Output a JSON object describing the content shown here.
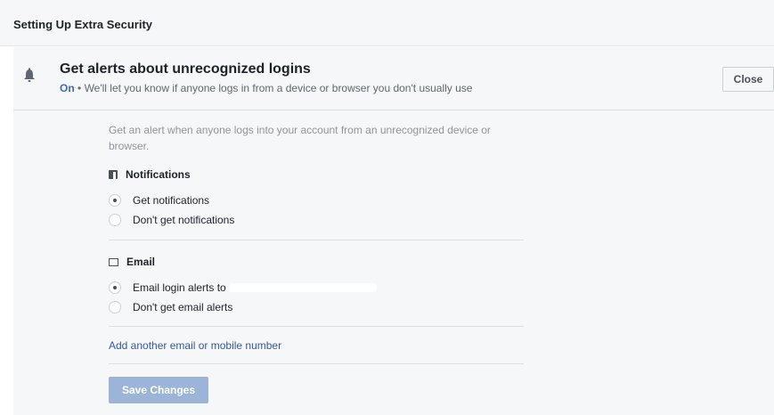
{
  "header": {
    "title": "Setting Up Extra Security"
  },
  "alert": {
    "title": "Get alerts about unrecognized logins",
    "status": "On",
    "separator": "•",
    "description": "We'll let you know if anyone logs in from a device or browser you don't usually use",
    "close_label": "Close"
  },
  "content": {
    "intro": "Get an alert when anyone logs into your account from an unrecognized device or browser.",
    "notifications": {
      "heading": "Notifications",
      "options": [
        {
          "label": "Get notifications",
          "selected": true
        },
        {
          "label": "Don't get notifications",
          "selected": false
        }
      ]
    },
    "email": {
      "heading": "Email",
      "options": [
        {
          "label": "Email login alerts to",
          "selected": true
        },
        {
          "label": "Don't get email alerts",
          "selected": false
        }
      ]
    },
    "add_link": "Add another email or mobile number",
    "save_label": "Save Changes"
  },
  "icons": [
    "bell-icon",
    "facebook-icon",
    "envelope-icon"
  ],
  "colors": {
    "accent": "#4267b2",
    "link": "#365899",
    "save_disabled": "#9cb4d8"
  }
}
